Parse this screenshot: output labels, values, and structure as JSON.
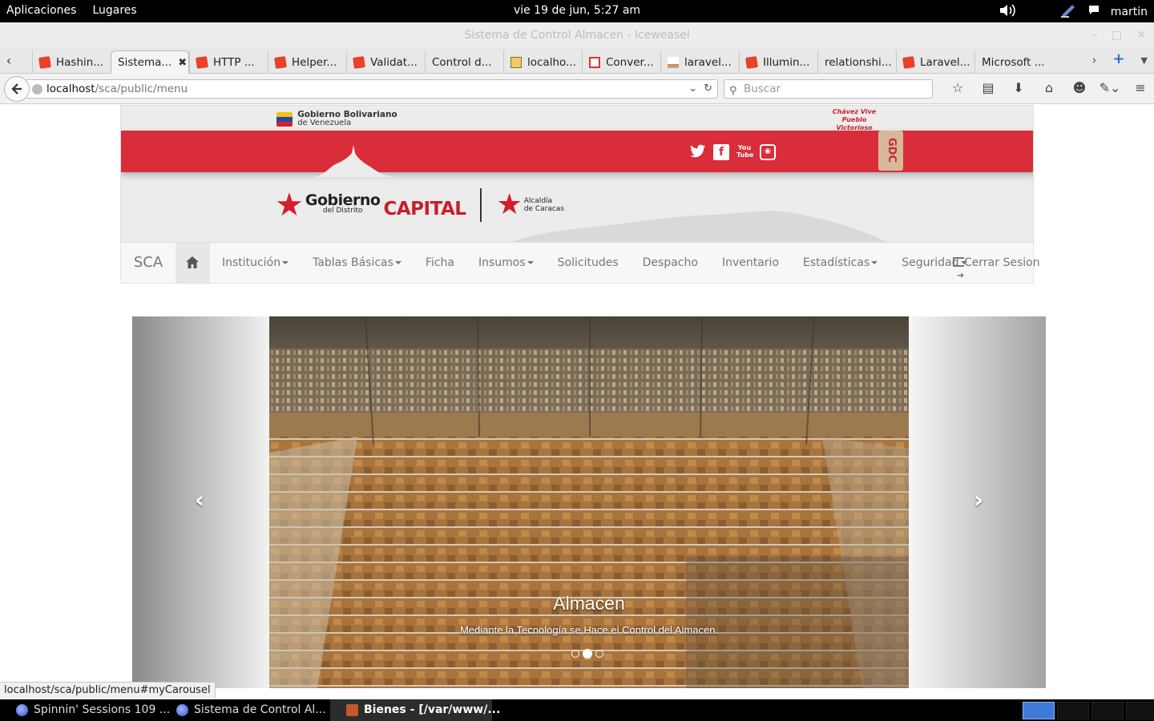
{
  "desktop": {
    "menu_applications": "Aplicaciones",
    "menu_places": "Lugares",
    "clock": "vie 19 de jun,  5:27 am",
    "user": "martin"
  },
  "window": {
    "title": "Sistema de Control Almacen - Iceweasel"
  },
  "tabs": [
    {
      "label": "Hashin...",
      "icon": "laravel-icon",
      "active": false
    },
    {
      "label": "Sistema...",
      "icon": "",
      "active": true
    },
    {
      "label": "HTTP ...",
      "icon": "laravel-icon",
      "active": false
    },
    {
      "label": "Helper...",
      "icon": "laravel-icon",
      "active": false
    },
    {
      "label": "Validat...",
      "icon": "laravel-icon",
      "active": false
    },
    {
      "label": "Control d...",
      "icon": "",
      "active": false
    },
    {
      "label": "localho...",
      "icon": "phpmyadmin-icon",
      "active": false
    },
    {
      "label": "Conver...",
      "icon": "gmail-icon",
      "active": false
    },
    {
      "label": "laravel...",
      "icon": "stackoverflow-icon",
      "active": false
    },
    {
      "label": "Illumin...",
      "icon": "laravel-icon",
      "active": false
    },
    {
      "label": "relationshi...",
      "icon": "",
      "active": false
    },
    {
      "label": "Laravel...",
      "icon": "laravel-icon",
      "active": false
    },
    {
      "label": "Microsoft ...",
      "icon": "",
      "active": false
    }
  ],
  "navbar": {
    "url_host": "localhost",
    "url_path": "/sca/public/menu",
    "search_placeholder": "Buscar"
  },
  "header": {
    "gov_line1": "Gobierno Bolivariano",
    "gov_line2": "de Venezuela",
    "pueblo_line1": "Chávez Vive",
    "pueblo_line2": "Pueblo Victorioso",
    "gdc": "GDC",
    "brand_gobierno": "Gobierno",
    "brand_distrito": "del Distrito",
    "brand_capital": "CAPITAL",
    "alcaldia_line1": "Alcaldía",
    "alcaldia_line2": "de Caracas"
  },
  "menu": {
    "brand": "SCA",
    "items": [
      {
        "label": "Institución",
        "dropdown": true
      },
      {
        "label": "Tablas Básicas",
        "dropdown": true
      },
      {
        "label": "Ficha",
        "dropdown": false
      },
      {
        "label": "Insumos",
        "dropdown": true
      },
      {
        "label": "Solicitudes",
        "dropdown": false
      },
      {
        "label": "Despacho",
        "dropdown": false
      },
      {
        "label": "Inventario",
        "dropdown": false
      },
      {
        "label": "Estadísticas",
        "dropdown": true
      },
      {
        "label": "Seguridad",
        "dropdown": true
      }
    ],
    "logout": "Cerrar Sesion"
  },
  "carousel": {
    "caption_title": "Almacen",
    "caption_text": "Mediante la Tecnología se Hace el Control del Almacen.",
    "slides_count": 3,
    "active_slide": 2,
    "prev_glyph": "‹",
    "next_glyph": "›"
  },
  "status_text": "localhost/sca/public/menu#myCarousel",
  "taskbar": [
    {
      "label": "Spinnin' Sessions 109 ...",
      "active": false
    },
    {
      "label": "Sistema de Control Al...",
      "active": false
    },
    {
      "label": "Bienes - [/var/www/...",
      "active": true
    }
  ],
  "colors": {
    "header_red": "#d92d3a",
    "accent_red": "#c81f2a",
    "navbar_bg": "#f7f7f7"
  }
}
